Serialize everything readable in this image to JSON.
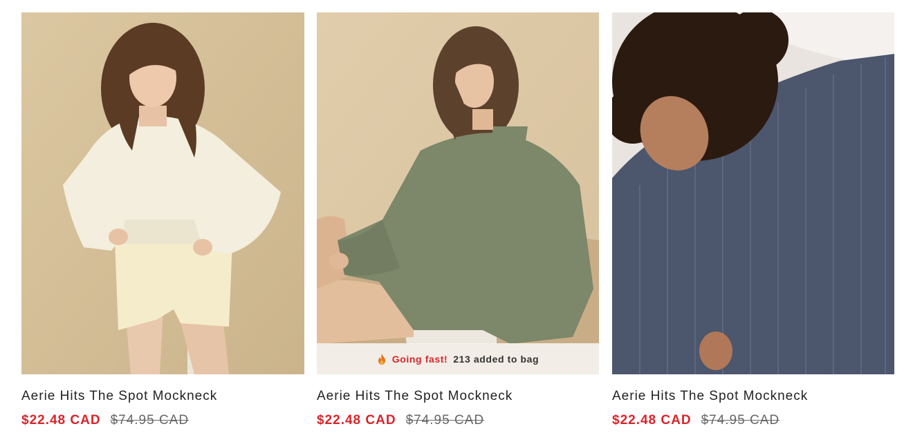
{
  "products": [
    {
      "name": "Aerie Hits The Spot Mockneck",
      "sale_price": "$22.48 CAD",
      "original_price": "$74.95 CAD",
      "image_icon": "cream-sweater-photo"
    },
    {
      "name": "Aerie Hits The Spot Mockneck",
      "sale_price": "$22.48 CAD",
      "original_price": "$74.95 CAD",
      "image_icon": "green-sweater-photo",
      "urgency": {
        "hot_label": "Going fast!",
        "count_label": "213 added to bag",
        "icon": "flame-icon"
      }
    },
    {
      "name": "Aerie Hits The Spot Mockneck",
      "sale_price": "$22.48 CAD",
      "original_price": "$74.95 CAD",
      "image_icon": "navy-sweater-photo"
    }
  ],
  "colors": {
    "sale": "#d8252b",
    "original": "#666666",
    "title": "#222222"
  }
}
